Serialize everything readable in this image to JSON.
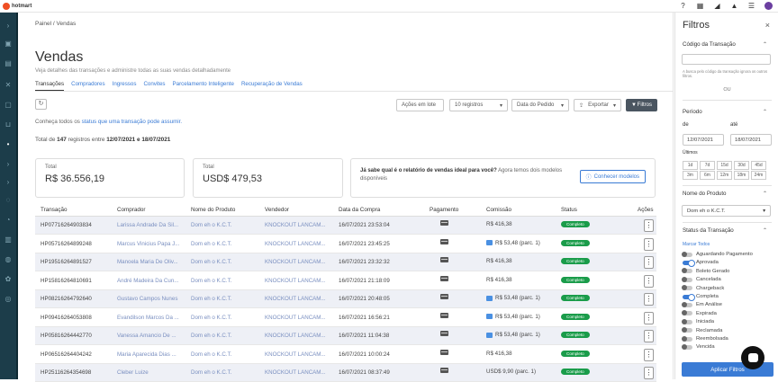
{
  "topbar": {
    "logo": "hotmart"
  },
  "breadcrumb": {
    "home": "Painel",
    "sep": "/",
    "current": "Vendas"
  },
  "page": {
    "title": "Vendas",
    "subtitle": "Veja detalhes das transações e administre todas as suas vendas detalhadamente"
  },
  "tabs": [
    "Transações",
    "Compradores",
    "Ingressos",
    "Convites",
    "Parcelamento Inteligente",
    "Recuperação de Vendas"
  ],
  "toolbar": {
    "refresh_icon": "↻",
    "bulk_actions": "Ações em lote",
    "page_size": "10 registros",
    "sort": "Data do Pedido",
    "export": "Exportar",
    "filters": "Filtros"
  },
  "info": {
    "prefix": "Conheça todos os ",
    "link": "status que uma transação pode assumir."
  },
  "totals": {
    "prefix": "Total de ",
    "count": "147",
    "middle": " registros entre ",
    "range": "12/07/2021 e 18/07/2021"
  },
  "cards": [
    {
      "label": "Total",
      "value": "R$ 36.556,19"
    },
    {
      "label": "Total",
      "value": "USD$ 479,53"
    }
  ],
  "promo": {
    "bold": "Já sabe qual é o relatório de vendas ideal para você?",
    "text": " Agora temos dois modelos disponíveis",
    "button": "Conhecer modelos"
  },
  "table": {
    "headers": [
      "Transação",
      "Comprador",
      "Nome do Produto",
      "Vendedor",
      "Data da Compra",
      "Pagamento",
      "Comissão",
      "Status",
      "Ações"
    ],
    "rows": [
      {
        "tx": "HP07716264903834",
        "buyer": "Larissa Andrade Da Sil...",
        "product": "Dom eh o K.C.T.",
        "seller": "KNOCKOUT LANCAM...",
        "date": "16/07/2021 23:53:04",
        "commission": "R$ 416,38",
        "installment": false,
        "status": "Completo"
      },
      {
        "tx": "HP05716264899248",
        "buyer": "Marcus Vinicius Papa J...",
        "product": "Dom eh o K.C.T.",
        "seller": "KNOCKOUT LANCAM...",
        "date": "16/07/2021 23:45:25",
        "commission": "R$ 53,48 (parc. 1)",
        "installment": true,
        "status": "Completo"
      },
      {
        "tx": "HP19516264891527",
        "buyer": "Manoela Maria De Oliv...",
        "product": "Dom eh o K.C.T.",
        "seller": "KNOCKOUT LANCAM...",
        "date": "16/07/2021 23:32:32",
        "commission": "R$ 416,38",
        "installment": false,
        "status": "Completo"
      },
      {
        "tx": "HP15816264810691",
        "buyer": "André Madeira Da Cun...",
        "product": "Dom eh o K.C.T.",
        "seller": "KNOCKOUT LANCAM...",
        "date": "16/07/2021 21:18:09",
        "commission": "R$ 416,38",
        "installment": false,
        "status": "Completo"
      },
      {
        "tx": "HP08216264792640",
        "buyer": "Gustavo Campos Nunes",
        "product": "Dom eh o K.C.T.",
        "seller": "KNOCKOUT LANCAM...",
        "date": "16/07/2021 20:48:05",
        "commission": "R$ 53,48 (parc. 1)",
        "installment": true,
        "status": "Completo"
      },
      {
        "tx": "HP09416264053808",
        "buyer": "Evandilson Marcos Da ...",
        "product": "Dom eh o K.C.T.",
        "seller": "KNOCKOUT LANCAM...",
        "date": "16/07/2021 16:56:21",
        "commission": "R$ 53,48 (parc. 1)",
        "installment": true,
        "status": "Completo"
      },
      {
        "tx": "HP05816264442770",
        "buyer": "Vanessa Amancio De ...",
        "product": "Dom eh o K.C.T.",
        "seller": "KNOCKOUT LANCAM...",
        "date": "16/07/2021 11:04:38",
        "commission": "R$ 53,48 (parc. 1)",
        "installment": true,
        "status": "Completo"
      },
      {
        "tx": "HP06516264404242",
        "buyer": "Maria Aparecida Dias ...",
        "product": "Dom eh o K.C.T.",
        "seller": "KNOCKOUT LANCAM...",
        "date": "16/07/2021 10:00:24",
        "commission": "R$ 416,38",
        "installment": false,
        "status": "Completo"
      },
      {
        "tx": "HP25116264354698",
        "buyer": "Cleber Luize",
        "product": "Dom eh o K.C.T.",
        "seller": "KNOCKOUT LANCAM...",
        "date": "16/07/2021 08:37:49",
        "commission": "USD$ 9,90 (parc. 1)",
        "installment": false,
        "status": "Completo"
      }
    ]
  },
  "filters": {
    "title": "Filtros",
    "close": "×",
    "code_section": "Código da Transação",
    "code_note": "A busca pelo código da transação ignora os outros filtros.",
    "or": "OU",
    "period_section": "Período",
    "from_label": "de",
    "to_label": "até",
    "from": "12/07/2021",
    "to": "18/07/2021",
    "last_label": "Últimos",
    "quick": [
      "1d",
      "7d",
      "15d",
      "30d",
      "45d",
      "3m",
      "6m",
      "12m",
      "18m",
      "24m"
    ],
    "product_section": "Nome do Produto",
    "product_value": "Dom eh o K.C.T.",
    "status_section": "Status da Transação",
    "mark_all": "Marcar Todos",
    "statuses": [
      {
        "label": "Aguardando Pagamento",
        "on": false
      },
      {
        "label": "Aprovada",
        "on": true
      },
      {
        "label": "Boleto Gerado",
        "on": false
      },
      {
        "label": "Cancelada",
        "on": false
      },
      {
        "label": "Chargeback",
        "on": false
      },
      {
        "label": "Completa",
        "on": true
      },
      {
        "label": "Em Análise",
        "on": false
      },
      {
        "label": "Expirada",
        "on": false
      },
      {
        "label": "Iniciada",
        "on": false
      },
      {
        "label": "Reclamada",
        "on": false
      },
      {
        "label": "Reembolsada",
        "on": false
      },
      {
        "label": "Vencida",
        "on": false
      }
    ],
    "apply": "Aplicar Filtros"
  }
}
